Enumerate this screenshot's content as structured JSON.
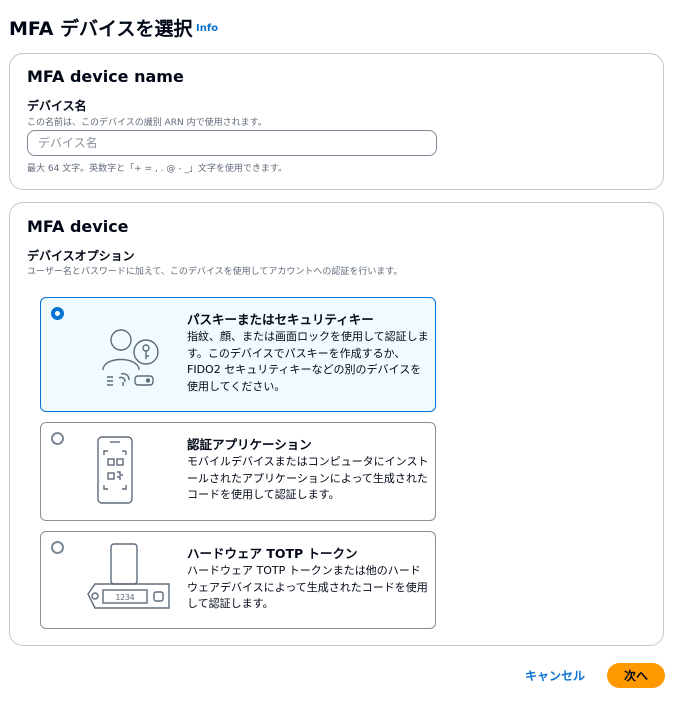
{
  "page": {
    "title": "MFA デバイスを選択",
    "info": "Info"
  },
  "name_panel": {
    "title": "MFA device name",
    "field_label": "デバイス名",
    "field_description": "この名前は、このデバイスの識別 ARN 内で使用されます。",
    "input_value": "",
    "input_placeholder": "デバイス名",
    "constraint": "最大 64 文字。英数字と「+ = , . @ - _」文字を使用できます。"
  },
  "device_panel": {
    "title": "MFA device",
    "field_label": "デバイスオプション",
    "field_description": "ユーザー名とパスワードに加えて、このデバイスを使用してアカウントへの認証を行います。",
    "options": [
      {
        "title": "パスキーまたはセキュリティキー",
        "description": "指紋、顔、または画面ロックを使用して認証します。このデバイスでパスキーを作成するか、FIDO2 セキュリティキーなどの別のデバイスを使用してください。",
        "selected": true,
        "icon": "user-key-fingerprint-icon"
      },
      {
        "title": "認証アプリケーション",
        "description": "モバイルデバイスまたはコンピュータにインストールされたアプリケーションによって生成されたコードを使用して認証します。",
        "selected": false,
        "icon": "phone-qr-code-icon"
      },
      {
        "title": "ハードウェア TOTP トークン",
        "description": "ハードウェア TOTP トークンまたは他のハードウェアデバイスによって生成されたコードを使用して認証します。",
        "selected": false,
        "icon": "hardware-token-icon",
        "token_display": "1234"
      }
    ]
  },
  "footer": {
    "cancel_label": "キャンセル",
    "next_label": "次へ"
  },
  "colors": {
    "accent": "#0972d3",
    "primary_button": "#ff9900",
    "selected_background": "#f0fbff",
    "border": "#c6c6cd"
  }
}
